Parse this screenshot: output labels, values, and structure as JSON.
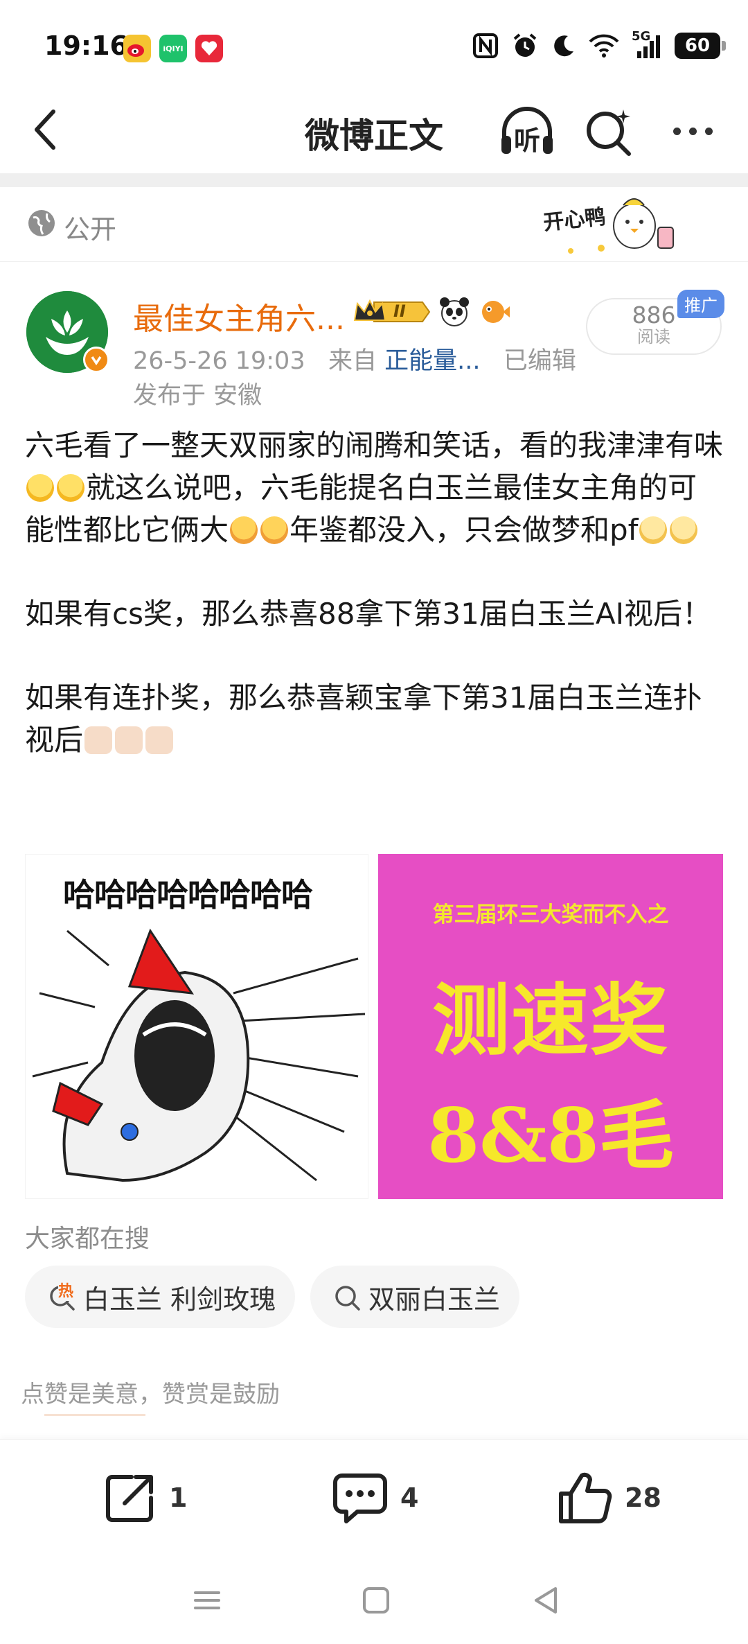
{
  "status_bar": {
    "time": "19:16",
    "battery": "60",
    "network": "5G",
    "icons": [
      "weibo-icon",
      "iqiyi-icon",
      "app-icon",
      "nfc-icon",
      "alarm-icon",
      "moon-icon",
      "wifi-icon",
      "signal-icon",
      "battery-icon"
    ],
    "iqiyi_label": "iQIYI"
  },
  "nav": {
    "title": "微博正文",
    "listen_label": "听"
  },
  "visibility": {
    "label": "公开",
    "sticker_text": "开心鸭"
  },
  "author": {
    "name": "最佳女主角六...",
    "rank_badge": "II",
    "timestamp": "26-5-26 19:03",
    "source_prefix": "来自",
    "source": "正能量...",
    "edited": "已编辑",
    "location": "发布于 安徽",
    "read_count": "886",
    "read_label": "阅读",
    "promo_tag": "推广"
  },
  "post": {
    "p1_a": "六毛看了一整天双丽家的闹腾和笑话，看的我津津有味",
    "p1_b": "就这么说吧，六毛能提名白玉兰最佳女主角的可能性都比它俩大",
    "p1_c": "年鉴都没入，只会做梦和pf",
    "p2": "如果有cs奖，那么恭喜88拿下第31届白玉兰AI视后！",
    "p3": "如果有连扑奖，那么恭喜颖宝拿下第31届白玉兰连扑视后"
  },
  "images": {
    "left_caption": "哈哈哈哈哈哈哈哈",
    "right_top": "第三届环三大奖而不入之",
    "right_main": "测速奖",
    "right_bottom": "8&8毛"
  },
  "trending": {
    "title": "大家都在搜",
    "chips": [
      {
        "label": "白玉兰 利剑玫瑰",
        "hot_label": "热"
      },
      {
        "label": "双丽白玉兰"
      }
    ]
  },
  "reward": {
    "text": "点赞是美意，赞赏是鼓励"
  },
  "actions": {
    "repost_count": "1",
    "comment_count": "4",
    "like_count": "28"
  },
  "colors": {
    "author_orange": "#e86b0c",
    "source_blue": "#2a5c9a",
    "promo_blue": "#5b8ce8",
    "image_magenta": "#e64ec4",
    "image_yellow": "#f6e82a"
  }
}
